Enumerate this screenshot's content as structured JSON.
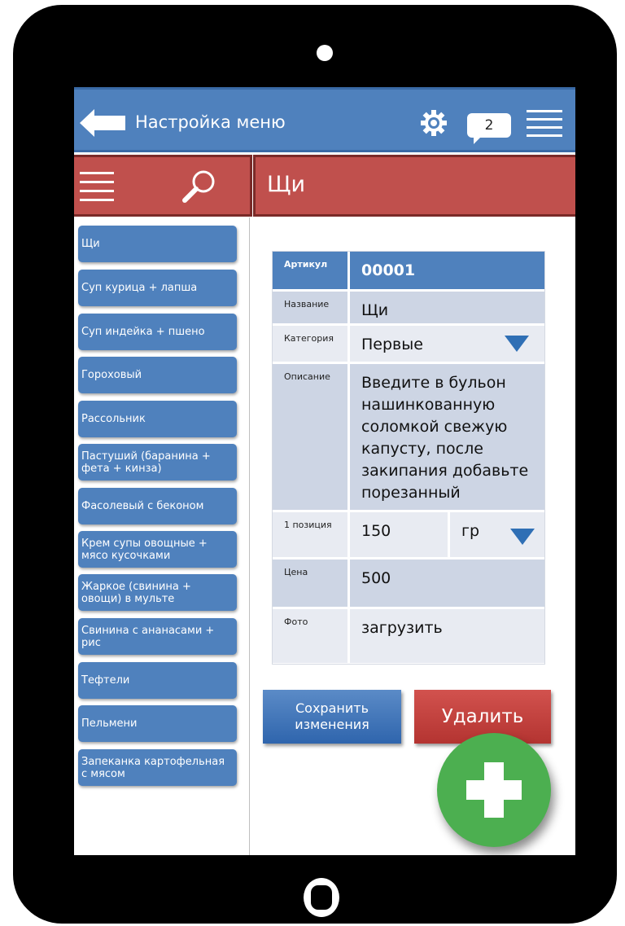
{
  "header": {
    "title": "Настройка меню",
    "notification_count": "2"
  },
  "section_title": "Щи",
  "sidebar": {
    "items": [
      "Щи",
      "Суп курица + лапша",
      "Суп индейка + пшено",
      "Гороховый",
      "Рассольник",
      "Пастуший (баранина + фета + кинза)",
      "Фасолевый с беконом",
      "Крем супы овощные + мясо кусочками",
      "Жаркое (свинина + овощи) в мульте",
      "Свинина с ананасами + рис",
      "Тефтели",
      "Пельмени",
      "Запеканка картофельная с мясом"
    ]
  },
  "form": {
    "sku": {
      "label": "Артикул",
      "value": "00001"
    },
    "name": {
      "label": "Название",
      "value": "Щи"
    },
    "category": {
      "label": "Категория",
      "value": "Первые"
    },
    "description": {
      "label": "Описание",
      "value": "Введите в бульон нашинкованную соломкой свежую капусту, после закипания добавьте порезанный"
    },
    "portion": {
      "label": "1 позиция",
      "value": "150",
      "unit": "гр"
    },
    "price": {
      "label": "Цена",
      "value": "500"
    },
    "photo": {
      "label": "Фото",
      "value": "загрузить"
    }
  },
  "actions": {
    "save": "Сохранить изменения",
    "delete": "Удалить"
  },
  "colors": {
    "blue": "#4f81bd",
    "red": "#c0504d",
    "green": "#4caf50"
  }
}
